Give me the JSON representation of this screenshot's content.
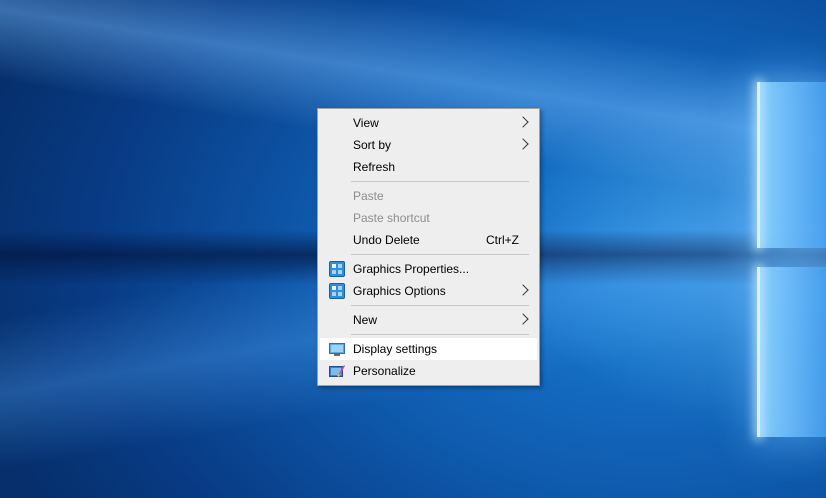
{
  "menu": {
    "groups": [
      [
        {
          "label": "View",
          "submenu": true
        },
        {
          "label": "Sort by",
          "submenu": true
        },
        {
          "label": "Refresh"
        }
      ],
      [
        {
          "label": "Paste",
          "disabled": true
        },
        {
          "label": "Paste shortcut",
          "disabled": true
        },
        {
          "label": "Undo Delete",
          "shortcut": "Ctrl+Z"
        }
      ],
      [
        {
          "label": "Graphics Properties...",
          "icon": "intel-graphics-icon"
        },
        {
          "label": "Graphics Options",
          "icon": "intel-graphics-icon",
          "submenu": true
        }
      ],
      [
        {
          "label": "New",
          "submenu": true
        }
      ],
      [
        {
          "label": "Display settings",
          "icon": "monitor-icon",
          "highlighted": true
        },
        {
          "label": "Personalize",
          "icon": "personalize-icon"
        }
      ]
    ]
  }
}
